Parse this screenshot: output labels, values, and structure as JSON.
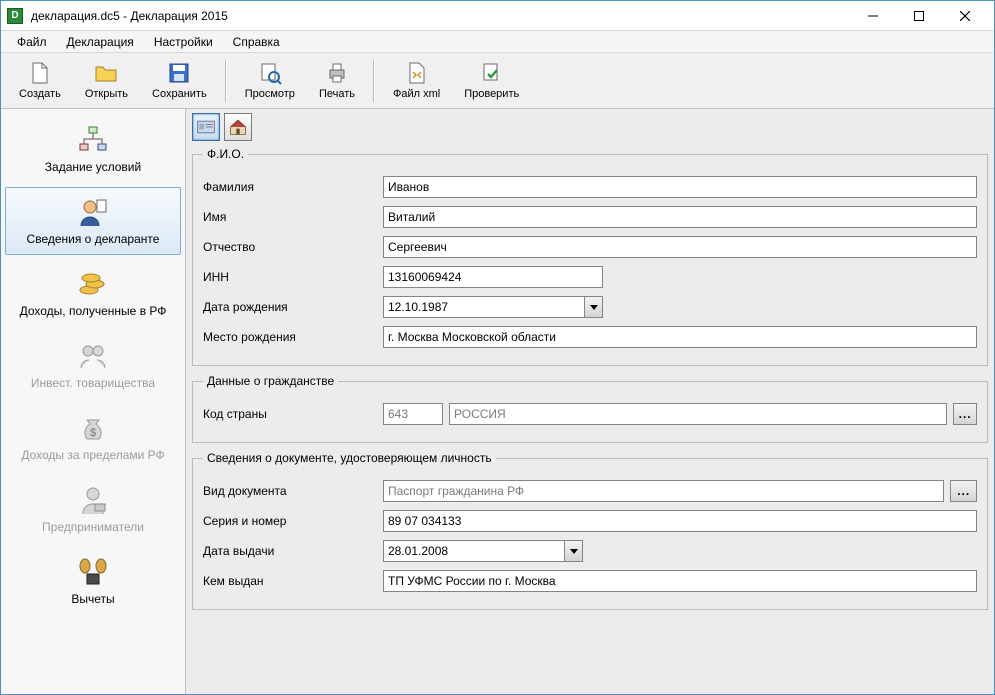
{
  "title": "декларация.dc5 - Декларация 2015",
  "menus": {
    "file": "Файл",
    "declaration": "Декларация",
    "settings": "Настройки",
    "help": "Справка"
  },
  "toolbar": {
    "create": "Создать",
    "open": "Открыть",
    "save": "Сохранить",
    "preview": "Просмотр",
    "print": "Печать",
    "filexml": "Файл xml",
    "check": "Проверить"
  },
  "sidebar": {
    "conditions": "Задание условий",
    "declarant": "Сведения о декларанте",
    "income_rf": "Доходы, полученные в РФ",
    "invest": "Инвест. товарищества",
    "income_abroad": "Доходы за пределами РФ",
    "entrepreneur": "Предприниматели",
    "deductions": "Вычеты"
  },
  "form": {
    "fio_legend": "Ф.И.О.",
    "last_name_label": "Фамилия",
    "last_name": "Иванов",
    "first_name_label": "Имя",
    "first_name": "Виталий",
    "patronymic_label": "Отчество",
    "patronymic": "Сергеевич",
    "inn_label": "ИНН",
    "inn": "13160069424",
    "birth_date_label": "Дата рождения",
    "birth_date": "12.10.1987",
    "birth_place_label": "Место рождения",
    "birth_place": "г. Москва Московской области",
    "citizenship_legend": "Данные о гражданстве",
    "country_code_label": "Код страны",
    "country_code": "643",
    "country_name": "РОССИЯ",
    "iddoc_legend": "Сведения о документе, удостоверяющем личность",
    "doc_kind_label": "Вид документа",
    "doc_kind": "Паспорт гражданина РФ",
    "doc_serial_label": "Серия и номер",
    "doc_serial": "89 07 034133",
    "doc_date_label": "Дата выдачи",
    "doc_date": "28.01.2008",
    "doc_issued_label": "Кем выдан",
    "doc_issued": "ТП УФМС России по г. Москва"
  }
}
